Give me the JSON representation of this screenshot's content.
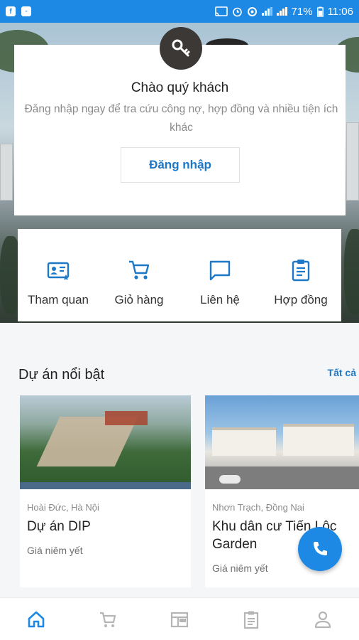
{
  "status_bar": {
    "battery": "71%",
    "time": "11:06",
    "left_icons": [
      "facebook-icon",
      "messenger-icon"
    ],
    "right_icons": [
      "cast-icon",
      "alarm-icon",
      "data-saver-icon",
      "wifi-signal-icon",
      "cell-signal-icon",
      "battery-icon"
    ]
  },
  "welcome": {
    "icon": "key-icon",
    "title": "Chào quý khách",
    "subtitle": "Đăng nhập ngay để tra cứu công nợ, hợp đồng và nhiều tiện ích khác",
    "login_label": "Đăng nhập"
  },
  "actions": [
    {
      "label": "Tham quan",
      "icon": "visit-card-icon"
    },
    {
      "label": "Giỏ hàng",
      "icon": "cart-icon"
    },
    {
      "label": "Liên hệ",
      "icon": "chat-icon"
    },
    {
      "label": "Hợp đồng",
      "icon": "clipboard-icon"
    }
  ],
  "featured": {
    "title": "Dự án nổi bật",
    "see_all": "Tất cả",
    "projects": [
      {
        "location": "Hoài Đức, Hà Nội",
        "name": "Dự án DIP",
        "price_label": "Giá niêm yết"
      },
      {
        "location": "Nhơn Trạch, Đồng Nai",
        "name": "Khu dân cư Tiến Lộc Garden",
        "price_label": "Giá niêm yết"
      }
    ]
  },
  "fab": {
    "icon": "phone-icon"
  },
  "bottom_nav": [
    {
      "icon": "home-icon",
      "active": true
    },
    {
      "icon": "cart-icon",
      "active": false
    },
    {
      "icon": "calendar-icon",
      "active": false
    },
    {
      "icon": "clipboard-icon",
      "active": false
    },
    {
      "icon": "profile-icon",
      "active": false
    }
  ],
  "colors": {
    "accent": "#1e88e5",
    "accent_text": "#1e78c8",
    "inactive_icon": "#b5b5b5",
    "key_circle": "#3b3836"
  }
}
